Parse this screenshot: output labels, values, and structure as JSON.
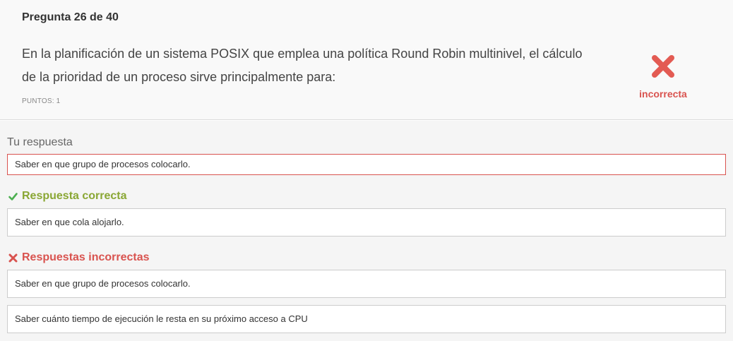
{
  "question": {
    "number_label": "Pregunta 26 de 40",
    "text_line1": "En la planificación de un sistema POSIX que emplea una política Round Robin multinivel, el cálculo",
    "text_line2": "de la prioridad de un proceso sirve principalmente para:",
    "points_label": "PUNTOS: 1",
    "result_icon": "cross-icon",
    "result_label": "incorrecta"
  },
  "answers": {
    "your_answer_label": "Tu respuesta",
    "your_answer": "Saber en que grupo de procesos colocarlo.",
    "correct_heading": "Respuesta correcta",
    "correct_answer": "Saber en que cola alojarlo.",
    "incorrect_heading": "Respuestas incorrectas",
    "incorrect_answers": [
      "Saber en que grupo de procesos colocarlo.",
      "Saber cuánto tiempo de ejecución le resta en su próximo acceso a CPU"
    ]
  },
  "colors": {
    "incorrect": "#d9534f",
    "correct": "#8aa734",
    "check_green": "#4caf50"
  }
}
